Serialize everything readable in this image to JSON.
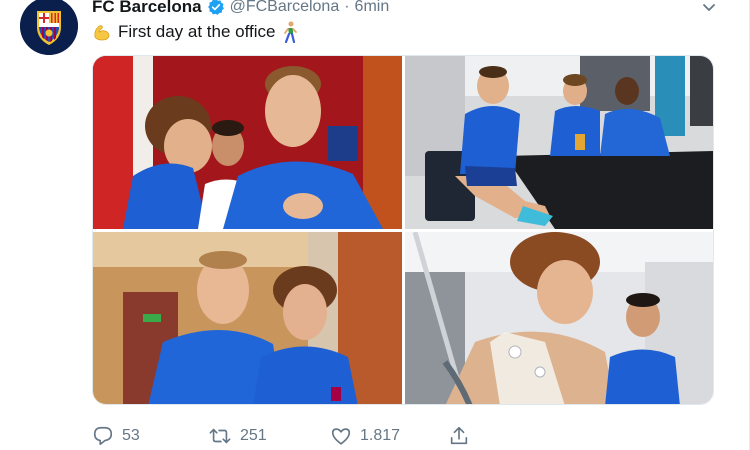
{
  "tweet": {
    "display_name": "FC Barcelona",
    "handle": "@FCBarcelona",
    "separator": "·",
    "time": "6min",
    "text": "First day at the office",
    "icons": {
      "avatar": "fc-barcelona-crest",
      "verified": "verified-badge-icon",
      "emoji_start": "flexed-biceps-emoji",
      "emoji_end": "person-walking-emoji",
      "menu": "chevron-down-icon"
    },
    "media": {
      "photos": [
        {
          "subject": "players-hugging-red-wall"
        },
        {
          "subject": "players-at-cafeteria-table"
        },
        {
          "subject": "two-players-in-hallway"
        },
        {
          "subject": "player-medical-test-electrodes"
        }
      ]
    },
    "actions": {
      "reply_count": "53",
      "retweet_count": "251",
      "like_count": "1.817",
      "share_label": ""
    },
    "colors": {
      "brand_navy": "#0b1f4d",
      "verified_blue": "#1da1f2",
      "kit_blue": "#1f5fd4",
      "muted_text": "#657786"
    }
  }
}
